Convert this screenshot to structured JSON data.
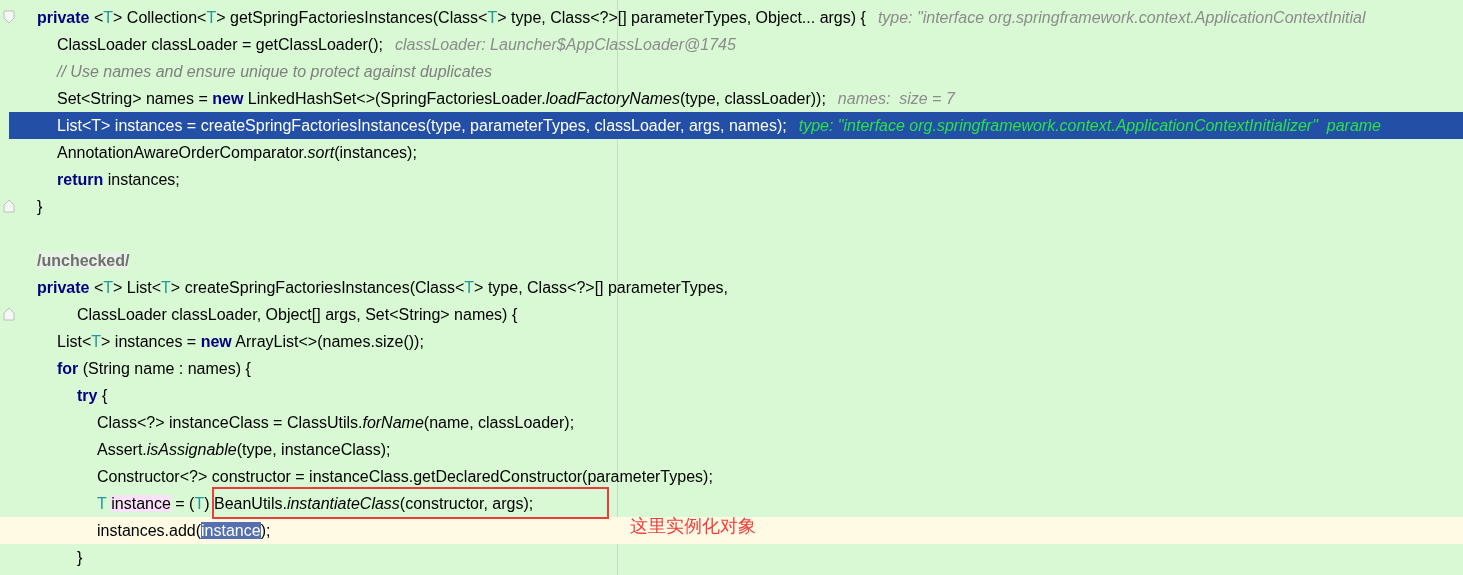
{
  "editor": {
    "lines": [
      {
        "fold": {
          "kind": "start"
        },
        "current": false,
        "caret": false,
        "tokens": [
          {
            "text": "private",
            "kind": "kw"
          },
          {
            "text": " <",
            "kind": "plain"
          },
          {
            "text": "T",
            "kind": "tp"
          },
          {
            "text": "> Collection<",
            "kind": "plain"
          },
          {
            "text": "T",
            "kind": "tp"
          },
          {
            "text": "> getSpringFactoriesInstances(Class<",
            "kind": "plain"
          },
          {
            "text": "T",
            "kind": "tp"
          },
          {
            "text": "> type, Class<?>[] parameterTypes, Object... args) {",
            "kind": "plain"
          }
        ],
        "hint": "type: \"interface org.springframework.context.ApplicationContextInitial",
        "children": [
          {
            "current": false,
            "caret": false,
            "tokens": [
              {
                "text": "ClassLoader classLoader = getClassLoader();",
                "kind": "plain"
              }
            ],
            "hint": "classLoader: Launcher$AppClassLoader@1745"
          },
          {
            "current": false,
            "caret": false,
            "tokens": [
              {
                "text": "// Use names and ensure unique to protect against duplicates",
                "kind": "comment"
              }
            ]
          },
          {
            "current": false,
            "caret": false,
            "tokens": [
              {
                "text": "Set<String> names = ",
                "kind": "plain"
              },
              {
                "text": "new",
                "kind": "kw"
              },
              {
                "text": " LinkedHashSet<>(SpringFactoriesLoader.",
                "kind": "plain"
              },
              {
                "text": "loadFactoryNames",
                "kind": "it"
              },
              {
                "text": "(type, classLoader));",
                "kind": "plain"
              }
            ],
            "hint": "names:  size = 7"
          },
          {
            "current": true,
            "caret": false,
            "tokens": [
              {
                "text": "List<",
                "kind": "plain"
              },
              {
                "text": "T",
                "kind": "tp"
              },
              {
                "text": "> instances = createSpringFactoriesInstances(type, parameterTypes, classLoader, args, names);",
                "kind": "plain"
              }
            ],
            "hint": "type: \"interface org.springframework.context.ApplicationContextInitializer\"  parame"
          },
          {
            "current": false,
            "caret": false,
            "tokens": [
              {
                "text": "AnnotationAwareOrderComparator.",
                "kind": "plain"
              },
              {
                "text": "sort",
                "kind": "it"
              },
              {
                "text": "(instances);",
                "kind": "plain"
              }
            ]
          },
          {
            "current": false,
            "caret": false,
            "tokens": [
              {
                "text": "return",
                "kind": "kw"
              },
              {
                "text": " instances;",
                "kind": "plain"
              }
            ]
          }
        ]
      },
      {
        "fold": {
          "kind": "end"
        },
        "current": false,
        "caret": false,
        "tokens": [
          {
            "text": "}",
            "kind": "plain"
          }
        ]
      },
      {
        "current": false,
        "caret": false
      },
      {
        "current": false,
        "caret": false,
        "tokens": [
          {
            "text": "/unchecked/",
            "kind": "ann"
          }
        ]
      },
      {
        "current": false,
        "caret": false,
        "tokens": [
          {
            "text": "private",
            "kind": "kw"
          },
          {
            "text": " <",
            "kind": "plain"
          },
          {
            "text": "T",
            "kind": "tp"
          },
          {
            "text": "> List<",
            "kind": "plain"
          },
          {
            "text": "T",
            "kind": "tp"
          },
          {
            "text": "> createSpringFactoriesInstances(Class<",
            "kind": "plain"
          },
          {
            "text": "T",
            "kind": "tp"
          },
          {
            "text": "> type, Class<?>[] parameterTypes,",
            "kind": "plain"
          }
        ],
        "continuation": {
          "fold": {
            "kind": "end"
          },
          "tokens": [
            {
              "text": "ClassLoader classLoader, Object[] args, Set<String> names) {",
              "kind": "plain"
            }
          ]
        },
        "children": [
          {
            "current": false,
            "caret": false,
            "tokens": [
              {
                "text": "List<",
                "kind": "plain"
              },
              {
                "text": "T",
                "kind": "tp"
              },
              {
                "text": "> instances = ",
                "kind": "plain"
              },
              {
                "text": "new",
                "kind": "kw"
              },
              {
                "text": " ArrayList<>(names.size());",
                "kind": "plain"
              }
            ]
          },
          {
            "current": false,
            "caret": false,
            "tokens": [
              {
                "text": "for",
                "kind": "kw"
              },
              {
                "text": " (String name : names) {",
                "kind": "plain"
              }
            ],
            "children": [
              {
                "current": false,
                "caret": false,
                "tokens": [
                  {
                    "text": "try",
                    "kind": "kw"
                  },
                  {
                    "text": " {",
                    "kind": "plain"
                  }
                ],
                "children": [
                  {
                    "current": false,
                    "caret": false,
                    "tokens": [
                      {
                        "text": "Class<?> instanceClass = ClassUtils.",
                        "kind": "plain"
                      },
                      {
                        "text": "forName",
                        "kind": "it"
                      },
                      {
                        "text": "(name, classLoader);",
                        "kind": "plain"
                      }
                    ]
                  },
                  {
                    "current": false,
                    "caret": false,
                    "tokens": [
                      {
                        "text": "Assert.",
                        "kind": "plain"
                      },
                      {
                        "text": "isAssignable",
                        "kind": "it"
                      },
                      {
                        "text": "(type, instanceClass);",
                        "kind": "plain"
                      }
                    ]
                  },
                  {
                    "current": false,
                    "caret": false,
                    "tokens": [
                      {
                        "text": "Constructor<?> constructor = instanceClass.getDeclaredConstructor(parameterTypes);",
                        "kind": "plain"
                      }
                    ]
                  },
                  {
                    "current": false,
                    "caret": false,
                    "tokens": [
                      {
                        "text": "T",
                        "kind": "tp"
                      },
                      {
                        "text": "instance",
                        "kind": "mark"
                      },
                      {
                        "text": " = (",
                        "kind": "plain"
                      },
                      {
                        "text": "T",
                        "kind": "tp"
                      },
                      {
                        "text": ") BeanUtils.",
                        "kind": "plain"
                      },
                      {
                        "text": "instantiateClass",
                        "kind": "it"
                      },
                      {
                        "text": "(constructor, args);",
                        "kind": "plain"
                      }
                    ]
                  },
                  {
                    "current": false,
                    "caret": true,
                    "tokens": [
                      {
                        "text": "instances.add(",
                        "kind": "plain"
                      },
                      {
                        "text": "instance",
                        "kind": "sel"
                      },
                      {
                        "text": ");",
                        "kind": "plain"
                      }
                    ]
                  }
                ]
              },
              {
                "current": false,
                "caret": false,
                "tokens": [
                  {
                    "text": "}",
                    "kind": "plain"
                  }
                ]
              }
            ]
          }
        ]
      }
    ]
  },
  "callout": {
    "note": "这里实例化对象"
  }
}
